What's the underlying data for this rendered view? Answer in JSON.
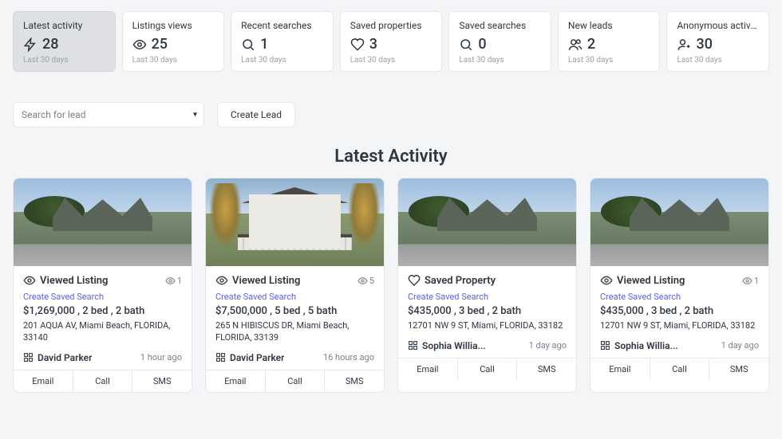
{
  "stats": [
    {
      "title": "Latest activity",
      "icon": "bolt",
      "value": "28",
      "sub": "Last 30 days"
    },
    {
      "title": "Listings views",
      "icon": "eye",
      "value": "25",
      "sub": "Last 30 days"
    },
    {
      "title": "Recent searches",
      "icon": "search",
      "value": "1",
      "sub": "Last 30 days"
    },
    {
      "title": "Saved properties",
      "icon": "heart",
      "value": "3",
      "sub": "Last 30 days"
    },
    {
      "title": "Saved searches",
      "icon": "search",
      "value": "0",
      "sub": "Last 30 days"
    },
    {
      "title": "New leads",
      "icon": "users",
      "value": "2",
      "sub": "Last 30 days"
    },
    {
      "title": "Anonymous activity",
      "icon": "anon",
      "value": "30",
      "sub": "Last 30 days"
    }
  ],
  "controls": {
    "search_placeholder": "Search for lead",
    "create_label": "Create Lead"
  },
  "heading": "Latest Activity",
  "cards": [
    {
      "action_icon": "eye",
      "action_label": "Viewed Listing",
      "views": "1",
      "save_link": "Create Saved Search",
      "price_line": "$1,269,000 , 2 bed , 2 bath",
      "address": "201 AQUA AV, Miami Beach, FLORIDA, 33140",
      "lead": "David Parker",
      "time": "1 hour ago",
      "buttons": [
        "Email",
        "Call",
        "SMS"
      ],
      "img": "a"
    },
    {
      "action_icon": "eye",
      "action_label": "Viewed Listing",
      "views": "5",
      "save_link": "Create Saved Search",
      "price_line": "$7,500,000 , 5 bed , 5 bath",
      "address": "265 N HIBISCUS DR, Miami Beach, FLORIDA, 33139",
      "lead": "David Parker",
      "time": "16 hours ago",
      "buttons": [
        "Email",
        "Call",
        "SMS"
      ],
      "img": "b"
    },
    {
      "action_icon": "heart",
      "action_label": "Saved Property",
      "views": "",
      "save_link": "Create Saved Search",
      "price_line": "$435,000 , 3 bed , 2 bath",
      "address": "12701 NW 9 ST, Miami, FLORIDA, 33182",
      "lead": "Sophia Willia...",
      "time": "1 day ago",
      "buttons": [
        "Email",
        "Call",
        "SMS"
      ],
      "img": "a"
    },
    {
      "action_icon": "eye",
      "action_label": "Viewed Listing",
      "views": "1",
      "save_link": "Create Saved Search",
      "price_line": "$435,000 , 3 bed , 2 bath",
      "address": "12701 NW 9 ST, Miami, FLORIDA, 33182",
      "lead": "Sophia Willia...",
      "time": "1 day ago",
      "buttons": [
        "Email",
        "Call",
        "SMS"
      ],
      "img": "a"
    }
  ]
}
